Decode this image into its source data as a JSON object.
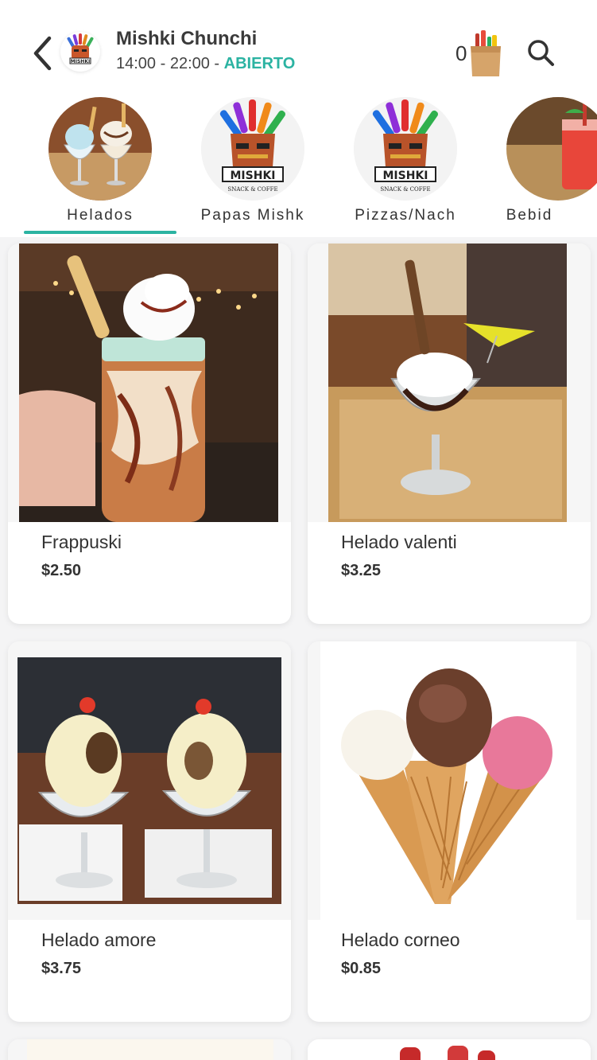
{
  "header": {
    "store_name": "Mishki Chunchi",
    "hours": "14:00 - 22:00 - ",
    "status": "ABIERTO",
    "cart_count": "0",
    "back_icon": "chevron-left-icon",
    "search_icon": "search-icon",
    "cart_icon": "shopping-bag-icon",
    "logo_text": "MISHKI"
  },
  "categories": [
    {
      "label": "Helados",
      "selected": true
    },
    {
      "label": "Papas Mishk",
      "selected": false
    },
    {
      "label": "Pizzas/Nach",
      "selected": false
    },
    {
      "label": "Bebid",
      "selected": false
    }
  ],
  "logo_caption": "SNACK & COFFE",
  "products": [
    {
      "name": "Frappuski",
      "price": "$2.50"
    },
    {
      "name": "Helado valenti",
      "price": "$3.25"
    },
    {
      "name": "Helado amore",
      "price": "$3.75"
    },
    {
      "name": "Helado corneo",
      "price": "$0.85"
    }
  ],
  "colors": {
    "accent": "#2bb3a2",
    "background": "#f4f4f5",
    "card": "#ffffff",
    "text": "#333333"
  }
}
